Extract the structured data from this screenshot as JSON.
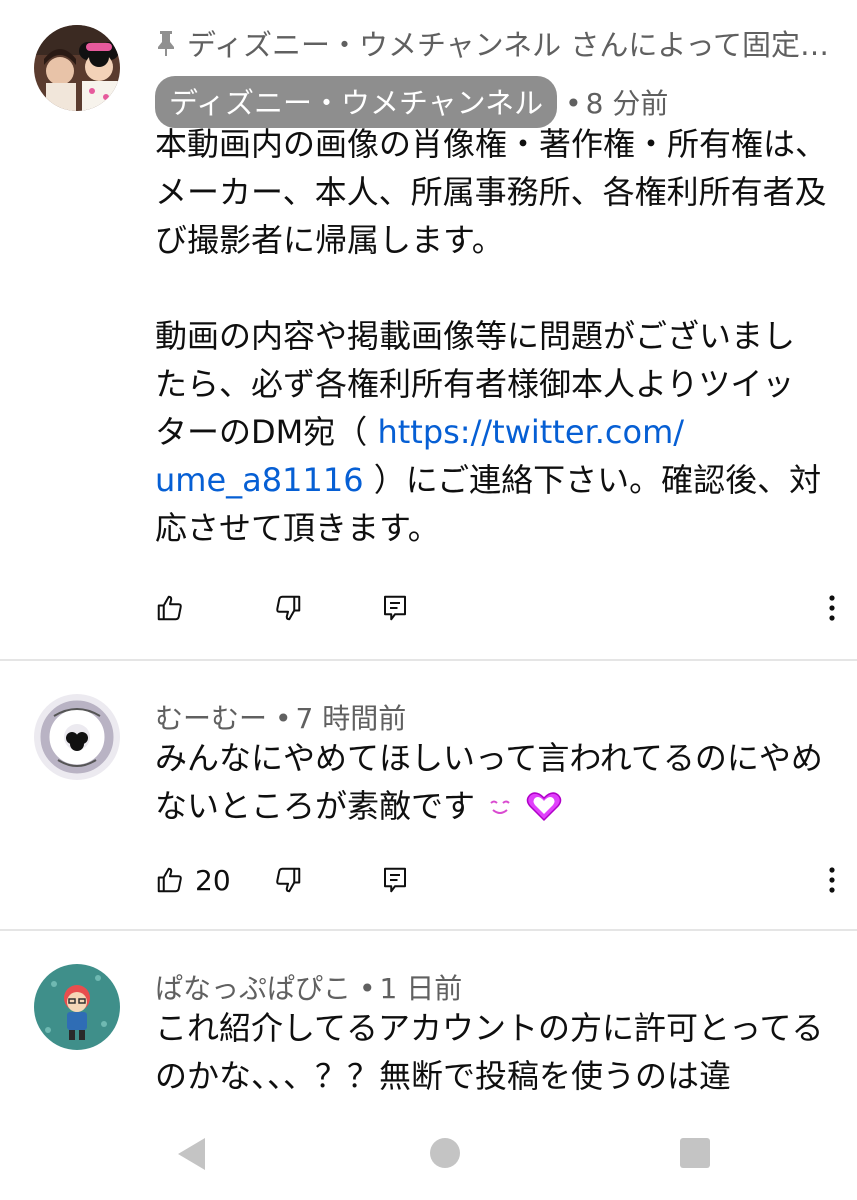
{
  "pinned_comment": {
    "pinned_label": "ディズニー・ウメチャンネル さんによって固定さ…",
    "author": "ディズニー・ウメチャンネル",
    "time": "8 分前",
    "paragraph1": "本動画内の画像の肖像権・著作権・所有権は、メーカー、本人、所属事務所、各権利所有者及び撮影者に帰属します。",
    "p2_line1": "動画の内容や掲載画像等に問題がございまし",
    "p2_line2": "たら、必ず各権利所有者様御本人よりツイッ",
    "p2_line3_text": "ターのDM宛（ ",
    "link_line1": "https://twitter.com/",
    "link_line2": "ume_a81116",
    "p2_line4_text": " ）にご連絡下さい。確認後、対",
    "p2_line5": "応させて頂きます。",
    "like_count": ""
  },
  "comment2": {
    "author": "むーむー",
    "time": "7 時間前",
    "text": "みんなにやめてほしいって言われてるのにやめないところが素敵です",
    "emoji1": "😊",
    "emoji2": "💗",
    "like_count": "20"
  },
  "comment3": {
    "author": "ぱなっぷぱぴこ",
    "time": "1 日前",
    "text": "これ紹介してるアカウントの方に許可とってるのかな、、、？？無断で投稿を使うのは違"
  },
  "meta_separator": "•",
  "colors": {
    "link": "#065fd4",
    "secondary_text": "#606060",
    "author_chip": "#8e8e8e",
    "divider": "#e5e5e5",
    "emoji_heart": "#e040fb"
  },
  "icons": [
    "pin-icon",
    "thumbs-up-icon",
    "thumbs-down-icon",
    "reply-icon",
    "more-vert-icon",
    "nav-back-icon",
    "nav-home-icon",
    "nav-recents-icon"
  ]
}
